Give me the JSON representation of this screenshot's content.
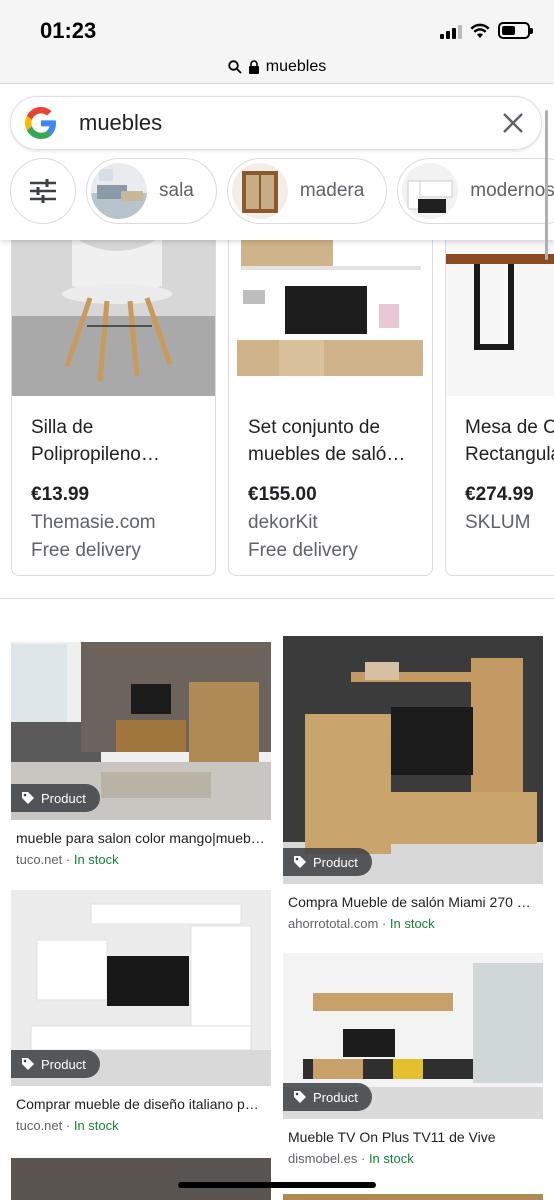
{
  "status_bar": {
    "time": "01:23"
  },
  "url_bar": {
    "domain": "muebles"
  },
  "search": {
    "query": "muebles"
  },
  "chips": [
    {
      "label": "sala"
    },
    {
      "label": "madera"
    },
    {
      "label": "modernos"
    }
  ],
  "products": [
    {
      "title": "Silla de\nPolipropileno…",
      "price": "€13.99",
      "store": "Themasie.com",
      "delivery": "Free delivery"
    },
    {
      "title": "Set conjunto de\nmuebles de saló…",
      "price": "€155.00",
      "store": "dekorKit",
      "delivery": "Free delivery"
    },
    {
      "title": "Mesa de C\nRectangula",
      "price": "€274.99",
      "store": "SKLUM",
      "delivery": ""
    }
  ],
  "grid": {
    "badge_label": "Product",
    "items": [
      {
        "title": "mueble para salon color mango|mueb…",
        "source": "tuco.net",
        "stock": "In stock"
      },
      {
        "title": "Compra Mueble de salón Miami 270 …",
        "source": "ahorrototal.com",
        "stock": "In stock"
      },
      {
        "title": "Comprar mueble de diseño italiano p…",
        "source": "tuco.net",
        "stock": "In stock"
      },
      {
        "title": "Mueble TV On Plus TV11 de Vive",
        "source": "dismobel.es",
        "stock": "In stock"
      }
    ]
  },
  "colors": {
    "stock_green": "#188038",
    "text_gray": "#5f6368",
    "border": "#dadce0"
  }
}
